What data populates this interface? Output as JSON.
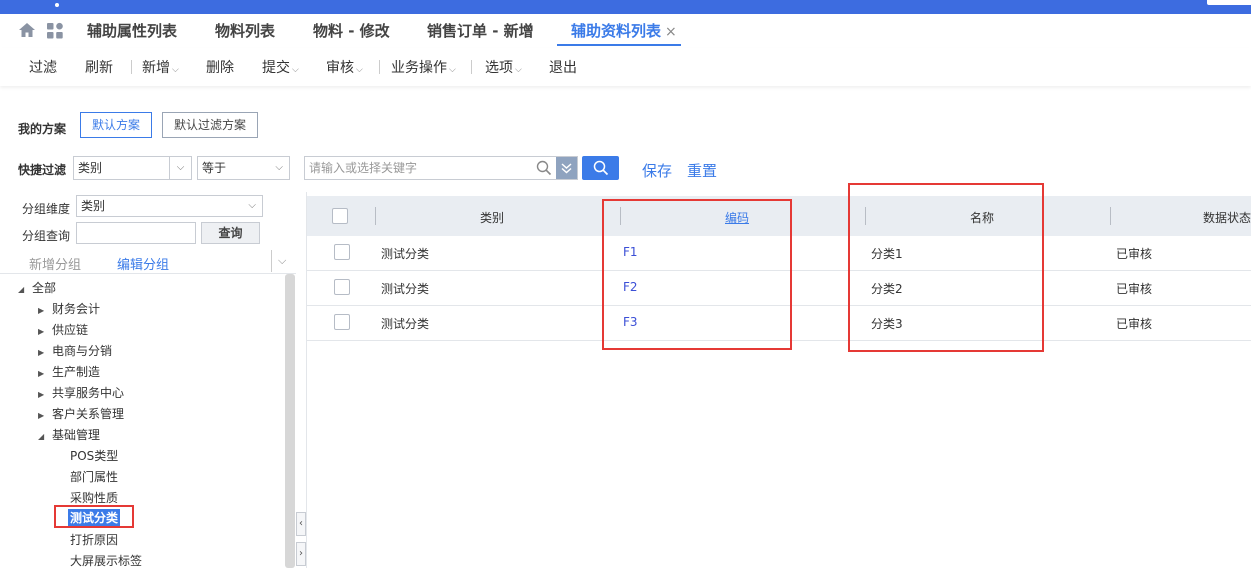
{
  "tabs": [
    {
      "label": "辅助属性列表"
    },
    {
      "label": "物料列表"
    },
    {
      "label": "物料 - 修改"
    },
    {
      "label": "销售订单 - 新增"
    },
    {
      "label": "辅助资料列表",
      "close": "×"
    }
  ],
  "toolbar": {
    "filter": "过滤",
    "refresh": "刷新",
    "add": "新增",
    "delete": "删除",
    "submit": "提交",
    "audit": "审核",
    "business": "业务操作",
    "options": "选项",
    "exit": "退出"
  },
  "scheme": {
    "label": "我的方案",
    "default_scheme": "默认方案",
    "default_filter_scheme": "默认过滤方案"
  },
  "quick_filter": {
    "label": "快捷过滤",
    "field": "类别",
    "operator": "等于",
    "placeholder": "请输入或选择关键字",
    "save": "保存",
    "reset": "重置"
  },
  "group": {
    "dimension_label": "分组维度",
    "dimension_value": "类别",
    "query_label": "分组查询",
    "query_button": "查询",
    "add_group": "新增分组",
    "edit_group": "编辑分组"
  },
  "tree": {
    "root": "全部",
    "nodes": [
      "财务会计",
      "供应链",
      "电商与分销",
      "生产制造",
      "共享服务中心",
      "客户关系管理",
      "基础管理"
    ],
    "children": [
      "POS类型",
      "部门属性",
      "采购性质",
      "测试分类",
      "打折原因",
      "大屏展示标签"
    ]
  },
  "table": {
    "columns": [
      "类别",
      "编码",
      "名称",
      "数据状态"
    ],
    "rows": [
      {
        "category": "测试分类",
        "code": "F1",
        "name": "分类1",
        "status": "已审核"
      },
      {
        "category": "测试分类",
        "code": "F2",
        "name": "分类2",
        "status": "已审核"
      },
      {
        "category": "测试分类",
        "code": "F3",
        "name": "分类3",
        "status": "已审核"
      }
    ]
  },
  "colors": {
    "accent": "#3b7be8",
    "top_bar": "#3d6ce0",
    "highlight_box": "#e53935",
    "link": "#3b4fd6"
  }
}
